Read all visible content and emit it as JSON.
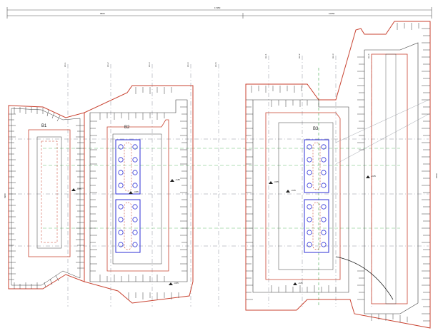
{
  "drawing": {
    "colors": {
      "outline": "#c8412f",
      "hatch": "#3a3a3a",
      "pile_cap": "#2c2fd6",
      "pile": "#2c2fd6",
      "axis": "#8a8f99",
      "green_axis": "#3aa84a",
      "dim": "#555555"
    },
    "labels": {
      "b1": "B1",
      "b2": "B2",
      "b3": "B3",
      "total_dim": "17450",
      "seg_dim_a": "6800",
      "seg_dim_b": "10650",
      "side_dim_left": "6900",
      "side_dim_right": "8750"
    },
    "axis_tags": [
      "H1-1",
      "H1-2",
      "H1-3",
      "H1-4",
      "H1-5",
      "H2-1",
      "H2-2",
      "H2-3",
      "H2-4"
    ],
    "elev_tags": [
      "-3.85",
      "-3.85",
      "-3.85",
      "-3.85",
      "-3.85",
      "-3.85",
      "-3.85",
      "-3.85"
    ]
  }
}
